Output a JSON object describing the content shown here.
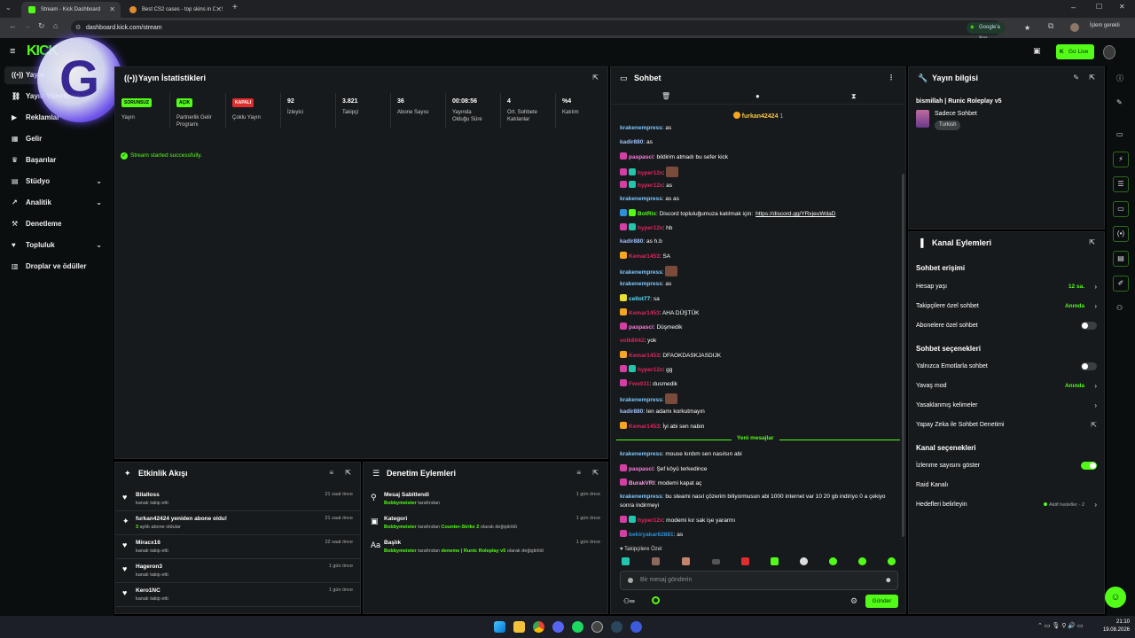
{
  "browser": {
    "tabs": [
      {
        "title": "Stream - Kick Dashboard",
        "active": true
      },
      {
        "title": "Best CS2 cases - top skins in CS2",
        "active": false
      }
    ],
    "url": "dashboard.kick.com/stream",
    "google_chip": "Google'a Sor",
    "profile_label": "İşlem gerekli"
  },
  "topnav": {
    "logo": "KICK",
    "go_live": "Go Live"
  },
  "sidebar": {
    "items": [
      {
        "label": "Yayın",
        "icon": "broadcast-icon",
        "active": true
      },
      {
        "label": "Yayın Yöneticisi",
        "icon": "link-icon"
      },
      {
        "label": "Reklamlar",
        "icon": "megaphone-icon"
      },
      {
        "label": "Gelir",
        "icon": "money-icon"
      },
      {
        "label": "Başarılar",
        "icon": "trophy-icon"
      },
      {
        "label": "Stüdyo",
        "icon": "studio-icon",
        "chevron": true
      },
      {
        "label": "Analitik",
        "icon": "analytics-icon",
        "chevron": true
      },
      {
        "label": "Denetleme",
        "icon": "hammer-icon"
      },
      {
        "label": "Topluluk",
        "icon": "users-icon",
        "chevron": true
      },
      {
        "label": "Droplar ve ödüller",
        "icon": "gift-icon"
      }
    ]
  },
  "stats": {
    "title": "Yayın İstatistikleri",
    "cells": [
      {
        "value": "SORUNSUZ",
        "label": "Yayın",
        "badge": "#53fc18"
      },
      {
        "value": "AÇIK",
        "label": "Partnerlik Gelir Programı",
        "badge": "#53fc18"
      },
      {
        "value": "KAPALI",
        "label": "Çoklu Yayın",
        "badge": "#e02d2d"
      },
      {
        "value": "92",
        "label": "İzleyici"
      },
      {
        "value": "3.821",
        "label": "Takipçi"
      },
      {
        "value": "36",
        "label": "Abone Sayısı"
      },
      {
        "value": "00:08:56",
        "label": "Yayında Olduğu Süre"
      },
      {
        "value": "4",
        "label": "Ort. Sohbete Katılanlar"
      },
      {
        "value": "%4",
        "label": "Katılım"
      }
    ],
    "status_message": "Stream started successfully."
  },
  "activity": {
    "title": "Etkinlik Akışı",
    "items": [
      {
        "name": "Bilalloss",
        "sub": "kanalı takip etti",
        "time": "21 saat önce",
        "icon": "heart-icon"
      },
      {
        "name": "furkan42424 yeniden abone oldu!",
        "sub_highlight": "3",
        "sub": "aylık abone oldular",
        "time": "21 saat önce",
        "icon": "sparkle-icon"
      },
      {
        "name": "Miracx16",
        "sub": "kanalı takip etti",
        "time": "22 saat önce",
        "icon": "heart-icon"
      },
      {
        "name": "Hageron3",
        "sub": "kanalı takip etti",
        "time": "1 gün önce",
        "icon": "heart-icon"
      },
      {
        "name": "Kero1NC",
        "sub": "kanalı takip etti",
        "time": "1 gün önce",
        "icon": "heart-icon"
      }
    ]
  },
  "moderation": {
    "title": "Denetim Eylemleri",
    "items": [
      {
        "title": "Mesaj Sabitlendi",
        "who": "Bobbymeister",
        "rest": "tarafından",
        "time": "1 gün önce",
        "icon": "pin-icon"
      },
      {
        "title": "Kategori",
        "who": "Bobbymeister",
        "rest": "tarafından",
        "hl": "Counter-Strike 2",
        "rest2": "olarak değiştirildi",
        "time": "1 gün önce",
        "icon": "category-icon"
      },
      {
        "title": "Başlık",
        "who": "Bobbymeister",
        "rest": "tarafından",
        "hl": "deneme | Runic Roleplay v5",
        "rest2": "olarak değiştirildi",
        "time": "1 gün önce",
        "icon": "text-icon"
      }
    ]
  },
  "chat": {
    "title": "Sohbet",
    "pinned_user": "furkan42424",
    "pinned_count": "1",
    "messages": [
      {
        "user": "krakenempress",
        "color": "#7ec8ff",
        "text": "as"
      },
      {
        "user": "kadir880",
        "color": "#9fc2ff",
        "text": "as"
      },
      {
        "user": "paspasci",
        "color": "#ff7de0",
        "text": "bildirim atmadı bu sefer kick",
        "badges": [
          "#d43fa3"
        ]
      },
      {
        "user": "hyper12x",
        "color": "#e0245e",
        "text": "",
        "emote": true,
        "badges": [
          "#d43fa3",
          "#23c5ac"
        ]
      },
      {
        "user": "hyper12x",
        "color": "#e0245e",
        "text": "as",
        "badges": [
          "#d43fa3",
          "#23c5ac"
        ]
      },
      {
        "user": "krakenempress",
        "color": "#7ec8ff",
        "text": "as as"
      },
      {
        "user": "BotRix",
        "color": "#53fc18",
        "text": "Discord topluluğumuza katılmak için:",
        "link": "https://discord.gg/YRxjeuWdaD",
        "badges": [
          "#2d8fd6",
          "#53fc18"
        ]
      },
      {
        "user": "hyper12x",
        "color": "#e0245e",
        "text": "hb",
        "badges": [
          "#d43fa3",
          "#23c5ac"
        ]
      },
      {
        "user": "kadir880",
        "color": "#9fc2ff",
        "text": "as h.b"
      },
      {
        "user": "Kemar1453",
        "color": "#e0245e",
        "text": "SA",
        "badges": [
          "#f5a623"
        ]
      },
      {
        "user": "krakenempress",
        "color": "#7ec8ff",
        "text": "",
        "emote": true
      },
      {
        "user": "krakenempress",
        "color": "#7ec8ff",
        "text": "as"
      },
      {
        "user": "cellot77",
        "color": "#55e0ff",
        "text": "sa",
        "badges": [
          "#e8e02d"
        ]
      },
      {
        "user": "Kemar1453",
        "color": "#e0245e",
        "text": "AHA DÜŞTÜK",
        "badges": [
          "#f5a623"
        ]
      },
      {
        "user": "paspasci",
        "color": "#ff7de0",
        "text": "Düşmedik",
        "badges": [
          "#d43fa3"
        ]
      },
      {
        "user": "volk8042",
        "color": "#e0245e",
        "text": "yok"
      },
      {
        "user": "Kemar1453",
        "color": "#e0245e",
        "text": "DFAOKDASKJASDIJK",
        "badges": [
          "#f5a623"
        ]
      },
      {
        "user": "hyper12x",
        "color": "#e0245e",
        "text": "gg",
        "badges": [
          "#d43fa3",
          "#23c5ac"
        ]
      },
      {
        "user": "Fwo011",
        "color": "#e0245e",
        "text": "dusmedik",
        "badges": [
          "#d43fa3"
        ]
      },
      {
        "user": "krakenempress",
        "color": "#7ec8ff",
        "text": "",
        "emote": true
      },
      {
        "user": "kadir880",
        "color": "#9fc2ff",
        "text": "len adamı korkutmayın"
      },
      {
        "user": "Kemar1453",
        "color": "#e0245e",
        "text": "İyi abi sen nabin",
        "badges": [
          "#f5a623"
        ]
      }
    ],
    "divider": "Yeni mesajlar",
    "new_messages": [
      {
        "user": "krakenempress",
        "color": "#7ec8ff",
        "text": "mouse kırdım sen nasılsın abi"
      },
      {
        "user": "paspasci",
        "color": "#ff7de0",
        "text": "Şef köyü terkedince",
        "badges": [
          "#d43fa3"
        ]
      },
      {
        "user": "BurakVRI",
        "color": "#ff9de8",
        "text": "modemi kapat aç",
        "badges": [
          "#d43fa3"
        ]
      },
      {
        "user": "krakenempress",
        "color": "#7ec8ff",
        "text": "bu steami nasıl çözerim biliyormusun abi 1000 internet var 10 20 gb indiriyo 0 a çekiyo sonra indirmeyi"
      },
      {
        "user": "hyper12x",
        "color": "#e0245e",
        "text": "modemi kır sak işe yararmı",
        "badges": [
          "#d43fa3",
          "#23c5ac"
        ]
      },
      {
        "user": "bekiryakar62881",
        "color": "#2d8fd6",
        "text": "as",
        "badges": [
          "#d43fa3"
        ]
      }
    ],
    "followers_only_label": "Takipçilere Özel",
    "input_placeholder": "Bir mesaj gönderin",
    "send_label": "Gönder"
  },
  "stream_info": {
    "title": "Yayın bilgisi",
    "stream_title": "bismillah | Runic Roleplay v5",
    "category": "Sadece Sohbet",
    "language": "Turkish"
  },
  "channel_actions": {
    "title": "Kanal Eylemleri",
    "chat_access": "Sohbet erişimi",
    "account_age": "Hesap yaşı",
    "account_age_value": "12 sa.",
    "followers_only": "Takipçilere özel sohbet",
    "followers_only_value": "Anında",
    "subs_only": "Abonelere özel sohbet",
    "chat_options": "Sohbet seçenekleri",
    "emote_only": "Yalnızca Emotlarla sohbet",
    "slow_mode": "Yavaş mod",
    "slow_mode_value": "Anında",
    "banned_words": "Yasaklanmış kelimeler",
    "ai_moderation": "Yapay Zeka ile Sohbet Denetimi",
    "channel_options": "Kanal seçenekleri",
    "show_viewers": "İzlenme sayısını göster",
    "raid": "Raid Kanalı",
    "goals": "Hedefleri belirleyin",
    "goals_value": "Aktif hedefler - 2"
  },
  "taskbar": {
    "time": "21:10",
    "date": "19.08.2026"
  },
  "colors": {
    "accent": "#53fc18",
    "panel": "#171a1c",
    "background": "#000000"
  }
}
